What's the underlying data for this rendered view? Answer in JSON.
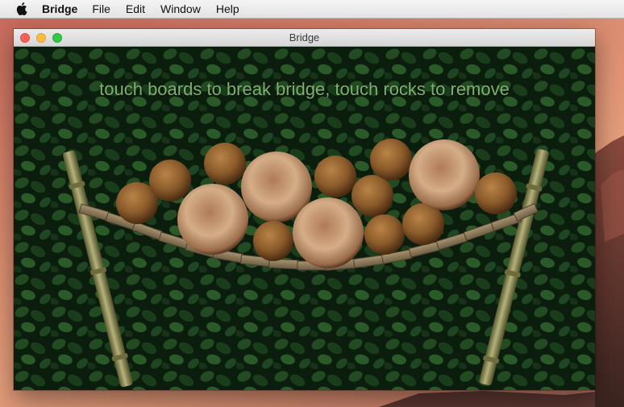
{
  "menubar": {
    "apple_icon": "apple-icon",
    "app_name": "Bridge",
    "items": [
      "File",
      "Edit",
      "Window",
      "Help"
    ]
  },
  "window": {
    "title": "Bridge",
    "buttons": [
      "close",
      "minimize",
      "zoom"
    ]
  },
  "game": {
    "instruction": "touch boards to break bridge, touch rocks to remove",
    "colors": {
      "foliage_dark": "#0d2410",
      "foliage_light": "#2f6b2e",
      "text": "#7fae6f",
      "plank": "#8a7a5e",
      "bamboo": "#8b8b58",
      "rock_small": "#8a5a2a",
      "rock_large": "#c49a72"
    },
    "board_count": 16,
    "rock_count": 15
  }
}
